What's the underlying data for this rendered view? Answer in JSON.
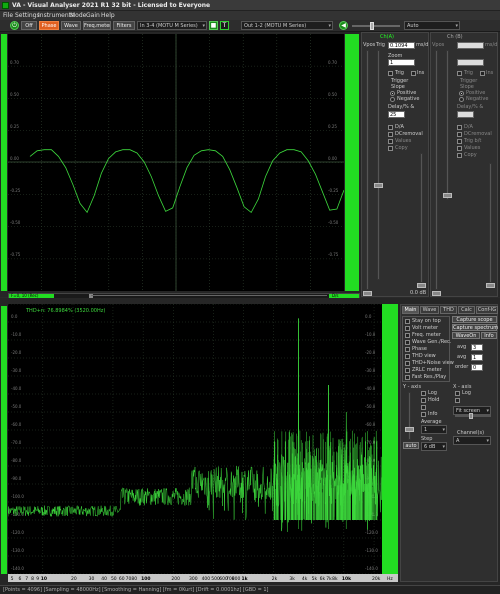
{
  "title": "VA - Visual Analyser 2021 R1 32 bit - Licensed to Everyone",
  "menu": [
    "File",
    "Settings",
    "Instruments",
    "Mode",
    "Gain",
    "Help"
  ],
  "toolbar": {
    "off": "Off",
    "phase": "Phase",
    "wave": "Wave",
    "freq_meter": "Freq.meter",
    "filters": "Filters",
    "input_device": "In 3-4 (MOTU M Series)",
    "output_device": "Out 1-2 (MOTU M Series)",
    "auto": "Auto"
  },
  "scope": {
    "y_labels_left": [
      "0.70",
      "0.50",
      "0.25",
      "0.00",
      "-0.25",
      "-0.50",
      "-0.75"
    ],
    "y_labels_right": [
      "0.70",
      "0.50",
      "0.25",
      "0.00",
      "-0.25",
      "-0.50",
      "-0.75"
    ],
    "bottom_left": "F=0, 10 (Rec)",
    "bottom_right": "D/s",
    "waveform": [
      0.2,
      0.15,
      0.14,
      0.14,
      0.2,
      0.3,
      0.45,
      0.62,
      0.7,
      0.55,
      0.35,
      0.22,
      0.16,
      0.14,
      0.14,
      0.17,
      0.25,
      0.38,
      0.55,
      0.69,
      0.66,
      0.47,
      0.3,
      0.19,
      0.15,
      0.14,
      0.15,
      0.2,
      0.32,
      0.48,
      0.65,
      0.7,
      0.58,
      0.38,
      0.24,
      0.17,
      0.14,
      0.14,
      0.16,
      0.24,
      0.36,
      0.52,
      0.68,
      0.67,
      0.5
    ]
  },
  "ch_a": {
    "title": "Ch(A)",
    "vpos": "Vpos",
    "trig": "Trig",
    "ms_div": "ms/d",
    "ms_value": "0.1094",
    "zoom": "Zoom",
    "zoom_value": "1",
    "trig_opt": "Trig",
    "ins": "Ins",
    "trigger": "Trigger",
    "slope": "Slope",
    "positive": "Positive",
    "negative": "Negative",
    "delay": "Delay/% &",
    "delay_value": "25",
    "da": "D/A",
    "dc_removal": "DCremoval",
    "values": "Values",
    "copy": "Copy",
    "db_label": "0.0 dB"
  },
  "ch_b": {
    "title": "Ch (B)",
    "vpos": "Vpos",
    "ms_div": "ms/d",
    "trig_opt": "Trig",
    "ins": "Ins",
    "trigger": "Trigger",
    "slope": "Slope",
    "positive": "Positive",
    "negative": "Negative",
    "delay": "Delay/% &",
    "da": "D/A",
    "dc_removal": "DCremoval",
    "trig_b": "Trig b/t",
    "values": "Values",
    "copy": "Copy"
  },
  "spectrum": {
    "thd_text": "THD+n: 76.8984% (3520.00Hz)",
    "db_labels": [
      "0.0",
      "-10.0",
      "-20.0",
      "-30.0",
      "-40.0",
      "-50.0",
      "-60.0",
      "-70.0",
      "-80.0",
      "-90.0",
      "-100.0",
      "-110.0",
      "-120.0",
      "-130.0",
      "-140.0",
      "-150.0"
    ],
    "freq_labels": [
      "5",
      "6",
      "7",
      "8",
      "9",
      "10",
      "20",
      "30",
      "40",
      "50",
      "60",
      "70",
      "80",
      "100",
      "200",
      "300",
      "400",
      "500",
      "600",
      "700",
      "800",
      "1k",
      "2k",
      "3k",
      "4k",
      "5k",
      "6k",
      "7k",
      "8k",
      "10k",
      "20k",
      "Hz"
    ],
    "peaks_khz": [
      3.52,
      7.04,
      10.56
    ],
    "peak_db": [
      -8,
      -45,
      -60
    ]
  },
  "right_panel": {
    "tabs": [
      "Main",
      "Wave",
      "THD",
      "Calc",
      "Conf-IG"
    ],
    "options": [
      "Stay on top",
      "Volt meter",
      "Freq. meter",
      "Wave Gen./Rec.",
      "Phase",
      "THD view",
      "THD+Noise view",
      "ZRLC meter",
      "Fast Res./Play"
    ],
    "capture_scope": "Capture scope",
    "capture_spectrum": "Capture spectrum",
    "wave_on": "WaveOn",
    "info": "Info",
    "spin_labels": [
      "avg",
      "avg",
      "order"
    ],
    "spin_values": [
      "3",
      "1",
      "0"
    ],
    "y_axis": "Y - axis",
    "log": "Log",
    "hold": "Hold",
    "x_axis": "X - axis",
    "log_x": "Log",
    "fit": "Fit screen",
    "average": "Average",
    "avg_value": "1",
    "step": "Step",
    "step_value": "6 dB",
    "auto": "auto",
    "channels": "Channel(s)",
    "channel_value": "A",
    "info_label": "Info"
  },
  "status": "[Points = 4096] [Sampling = 48000Hz] [Smoothing = Hanning] [fm = 0Kurt] [Drift = 0.0001hz] [GBD = 1]"
}
